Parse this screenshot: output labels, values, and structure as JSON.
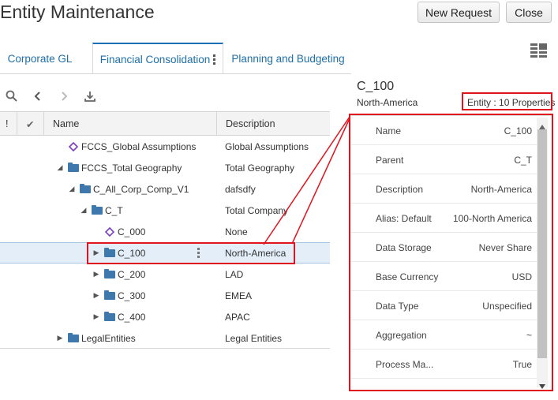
{
  "header": {
    "title": "Entity Maintenance",
    "new_request_label": "New Request",
    "close_label": "Close"
  },
  "tabs": [
    {
      "label": "Corporate GL",
      "active": false
    },
    {
      "label": "Financial Consolidation",
      "active": true
    },
    {
      "label": "Planning and Budgeting",
      "active": false
    }
  ],
  "toolbar": {
    "icons": [
      "search-icon",
      "back-icon",
      "forward-icon",
      "download-icon"
    ]
  },
  "grid": {
    "columns": {
      "flag": "!",
      "check": "✔",
      "name": "Name",
      "description": "Description"
    },
    "rows": [
      {
        "name": "FCCS_Global Assumptions",
        "description": "Global Assumptions",
        "icon": "member-diamond-icon",
        "expand": "none",
        "level": 1
      },
      {
        "name": "FCCS_Total Geography",
        "description": "Total Geography",
        "icon": "folder-icon",
        "expand": "expanded",
        "level": 1
      },
      {
        "name": "C_All_Corp_Comp_V1",
        "description": "dafsdfy",
        "icon": "folder-icon",
        "expand": "expanded",
        "level": 2
      },
      {
        "name": "C_T",
        "description": "Total Company",
        "icon": "folder-icon",
        "expand": "expanded",
        "level": 3
      },
      {
        "name": "C_000",
        "description": "None",
        "icon": "member-diamond-icon",
        "expand": "none",
        "level": 4
      },
      {
        "name": "C_100",
        "description": "North-America",
        "icon": "folder-icon",
        "expand": "collapsed",
        "level": 4,
        "selected": true
      },
      {
        "name": "C_200",
        "description": "LAD",
        "icon": "folder-icon",
        "expand": "collapsed",
        "level": 4
      },
      {
        "name": "C_300",
        "description": "EMEA",
        "icon": "folder-icon",
        "expand": "collapsed",
        "level": 4
      },
      {
        "name": "C_400",
        "description": "APAC",
        "icon": "folder-icon",
        "expand": "collapsed",
        "level": 4
      },
      {
        "name": "LegalEntities",
        "description": "Legal Entities",
        "icon": "folder-icon",
        "expand": "collapsed",
        "level": 0
      }
    ]
  },
  "selection": {
    "name": "C_100",
    "description": "North-America",
    "property_count_label": "Entity : 10 Properties"
  },
  "properties": [
    {
      "label": "Name",
      "value": "C_100"
    },
    {
      "label": "Parent",
      "value": "C_T"
    },
    {
      "label": "Description",
      "value": "North-America"
    },
    {
      "label": "Alias: Default",
      "value": "100-North America"
    },
    {
      "label": "Data Storage",
      "value": "Never Share"
    },
    {
      "label": "Base Currency",
      "value": "USD"
    },
    {
      "label": "Data Type",
      "value": "Unspecified"
    },
    {
      "label": "Aggregation",
      "value": "~"
    },
    {
      "label": "Process Ma...",
      "value": "True"
    }
  ],
  "colors": {
    "accent": "#1a6fb5",
    "folder": "#3f78ad",
    "member": "#7b3fbf",
    "annotation": "#e0141e",
    "selected_row": "#e3eef9"
  }
}
